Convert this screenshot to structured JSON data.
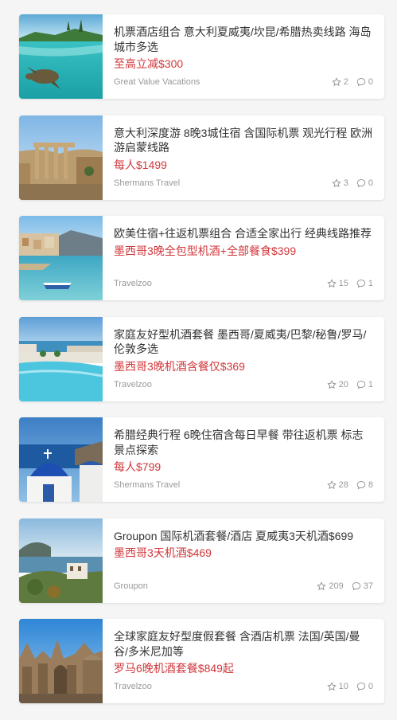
{
  "deals": [
    {
      "title": "机票酒店组合 意大利夏威夷/坎昆/希腊热卖线路 海岛城市多选",
      "price": "至高立减$300",
      "source": "Great Value Vacations",
      "likes": "2",
      "comments": "0",
      "image": "turtle-lagoon-photo"
    },
    {
      "title": "意大利深度游 8晚3城住宿 含国际机票 观光行程 欧洲游启蒙线路",
      "price": "每人$1499",
      "source": "Shermans Travel",
      "likes": "3",
      "comments": "0",
      "image": "roman-forum-photo"
    },
    {
      "title": "欧美住宿+往返机票组合 合适全家出行 经典线路推荐",
      "price": "墨西哥3晚全包型机酒+全部餐食$399",
      "source": "Travelzoo",
      "likes": "15",
      "comments": "1",
      "image": "coastal-town-boat-photo"
    },
    {
      "title": "家庭友好型机酒套餐 墨西哥/夏威夷/巴黎/秘鲁/罗马/伦敦多选",
      "price": "墨西哥3晚机酒含餐仅$369",
      "source": "Travelzoo",
      "likes": "20",
      "comments": "1",
      "image": "resort-pool-photo"
    },
    {
      "title": "希腊经典行程 6晚住宿含每日早餐 带往返机票 标志景点探索",
      "price": "每人$799",
      "source": "Shermans Travel",
      "likes": "28",
      "comments": "8",
      "image": "santorini-dome-photo"
    },
    {
      "title": "Groupon 国际机酒套餐/酒店 夏威夷3天机酒$699",
      "price": "墨西哥3天机酒$469",
      "source": "Groupon",
      "likes": "209",
      "comments": "37",
      "image": "mediterranean-coast-photo"
    },
    {
      "title": "全球家庭友好型度假套餐 含酒店机票 法国/英国/曼谷/多米尼加等",
      "price": "罗马6晚机酒套餐$849起",
      "source": "Travelzoo",
      "likes": "10",
      "comments": "0",
      "image": "gothic-cathedral-photo"
    }
  ],
  "colors": {
    "price": "#d0373b",
    "meta": "#999999",
    "title": "#333333"
  },
  "icons": {
    "likes": "star-icon",
    "comments": "comment-bubble-icon"
  }
}
